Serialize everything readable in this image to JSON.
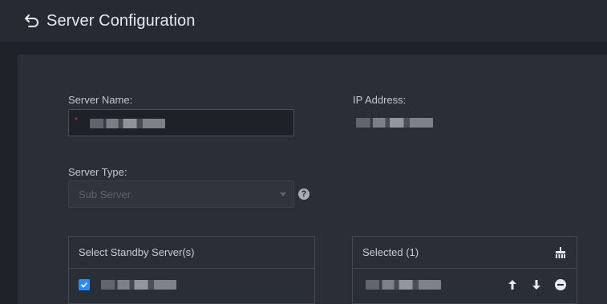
{
  "header": {
    "title": "Server Configuration"
  },
  "form": {
    "server_name_label": "Server Name:",
    "ip_address_label": "IP Address:",
    "server_type_label": "Server Type:",
    "server_type_value": "Sub Server"
  },
  "standby": {
    "header": "Select Standby Server(s)",
    "items": [
      {
        "checked": true
      }
    ]
  },
  "selected": {
    "header": "Selected (1)"
  },
  "icons": {
    "back": "back-arrow-icon",
    "help": "question-circle-icon",
    "clear": "broom-icon",
    "up": "arrow-up-icon",
    "down": "arrow-down-icon",
    "remove": "minus-circle-icon"
  }
}
